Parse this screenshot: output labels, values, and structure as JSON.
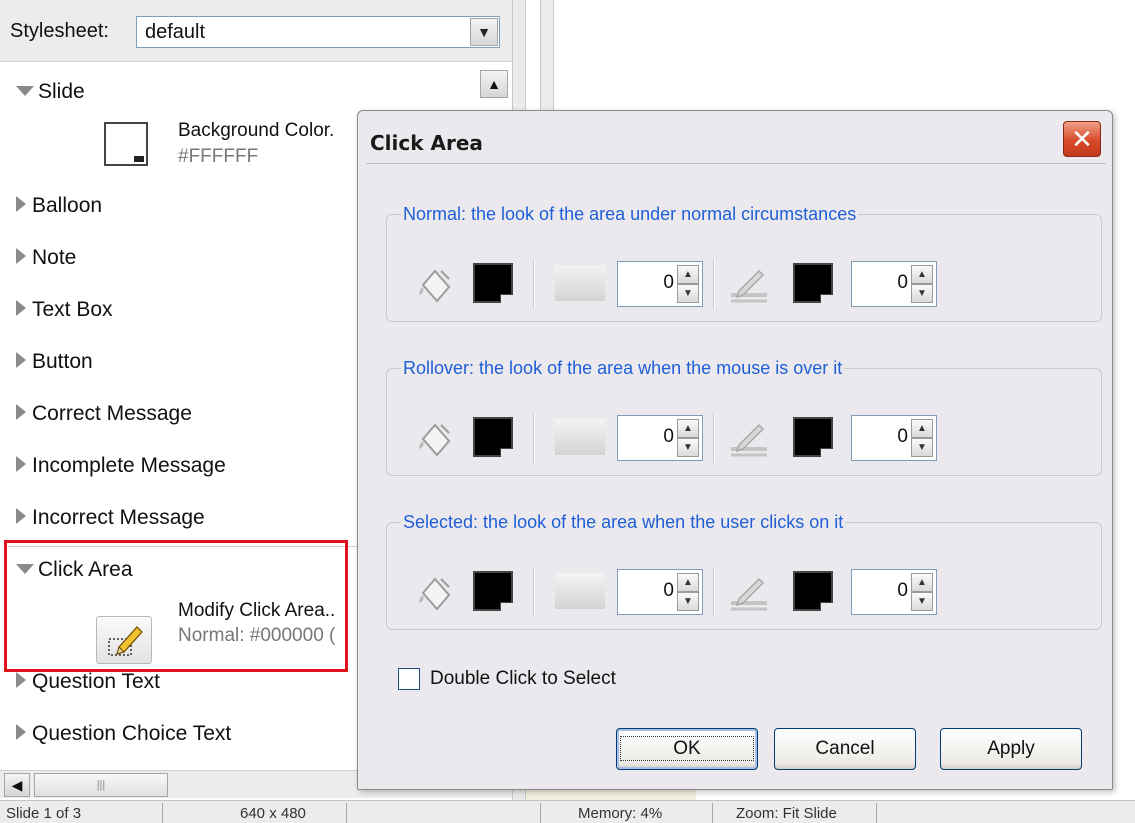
{
  "left_panel": {
    "stylesheet_label": "Stylesheet:",
    "stylesheet_value": "default",
    "tree": [
      {
        "label": "Slide",
        "expanded": true
      },
      {
        "label": "Balloon",
        "expanded": false
      },
      {
        "label": "Note",
        "expanded": false
      },
      {
        "label": "Text Box",
        "expanded": false
      },
      {
        "label": "Button",
        "expanded": false
      },
      {
        "label": "Correct Message",
        "expanded": false
      },
      {
        "label": "Incomplete Message",
        "expanded": false
      },
      {
        "label": "Incorrect Message",
        "expanded": false
      },
      {
        "label": "Click Area",
        "expanded": true
      },
      {
        "label": "Question Text",
        "expanded": false
      },
      {
        "label": "Question Choice Text",
        "expanded": false
      }
    ],
    "slide_bg_label": "Background Color.",
    "slide_bg_value": "#FFFFFF",
    "click_area_label": "Modify Click Area..",
    "click_area_value": "Normal: #000000 ("
  },
  "statusbar": {
    "cell1": "Slide 1 of 3",
    "cell2": "640 x 480",
    "cell3": "Memory: 4%",
    "cell4": "Zoom: Fit Slide"
  },
  "dialog": {
    "title": "Click Area",
    "close_icon": "close-icon",
    "groups": [
      {
        "legend": "Normal: the look of the area under normal circumstances",
        "fill_opacity": "0",
        "border_width": "0"
      },
      {
        "legend": "Rollover: the look of the area when the mouse is over it",
        "fill_opacity": "0",
        "border_width": "0"
      },
      {
        "legend": "Selected: the look of the area when the user clicks on it",
        "fill_opacity": "0",
        "border_width": "0"
      }
    ],
    "checkbox_label": "Double Click to Select",
    "checkbox_checked": false,
    "buttons": {
      "ok": "OK",
      "cancel": "Cancel",
      "apply": "Apply"
    }
  },
  "colors": {
    "accent_blue": "#1f5fd6",
    "highlight_red": "#e0131c",
    "close_red": "#d84a2a"
  }
}
